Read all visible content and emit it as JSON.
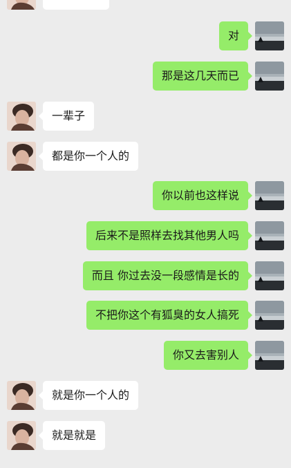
{
  "colors": {
    "background": "#ececec",
    "sent_bubble": "#95ec69",
    "received_bubble": "#ffffff"
  },
  "messages": [
    {
      "side": "left",
      "text": "",
      "avatar": "contact-avatar"
    },
    {
      "side": "right",
      "text": "对",
      "avatar": "my-avatar"
    },
    {
      "side": "right",
      "text": "那是这几天而已",
      "avatar": "my-avatar"
    },
    {
      "side": "left",
      "text": "一辈子",
      "avatar": "contact-avatar"
    },
    {
      "side": "left",
      "text": "都是你一个人的",
      "avatar": "contact-avatar"
    },
    {
      "side": "right",
      "text": "你以前也这样说",
      "avatar": "my-avatar"
    },
    {
      "side": "right",
      "text": "后来不是照样去找其他男人吗",
      "avatar": "my-avatar"
    },
    {
      "side": "right",
      "text": "而且 你过去没一段感情是长的",
      "avatar": "my-avatar"
    },
    {
      "side": "right",
      "text": "不把你这个有狐臭的女人搞死",
      "avatar": "my-avatar"
    },
    {
      "side": "right",
      "text": "你又去害别人",
      "avatar": "my-avatar"
    },
    {
      "side": "left",
      "text": "就是你一个人的",
      "avatar": "contact-avatar"
    },
    {
      "side": "left",
      "text": "就是就是",
      "avatar": "contact-avatar"
    }
  ]
}
